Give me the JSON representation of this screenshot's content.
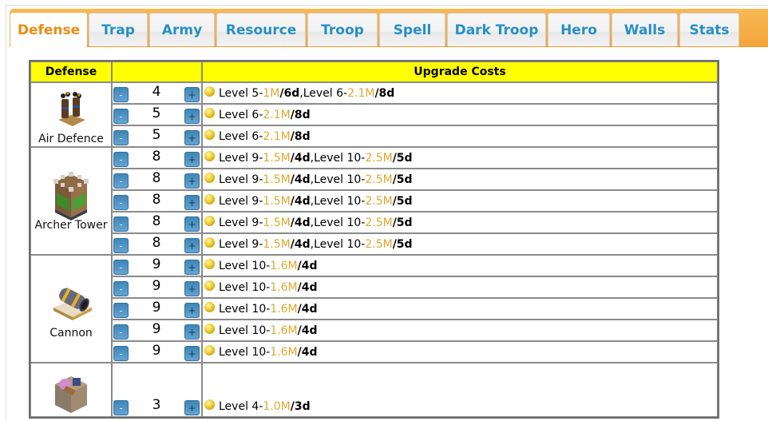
{
  "tabs": [
    {
      "label": "Defense",
      "active": true
    },
    {
      "label": "Trap",
      "active": false
    },
    {
      "label": "Army",
      "active": false
    },
    {
      "label": "Resource",
      "active": false
    },
    {
      "label": "Troop",
      "active": false
    },
    {
      "label": "Spell",
      "active": false
    },
    {
      "label": "Dark Troop",
      "active": false
    },
    {
      "label": "Hero",
      "active": false
    },
    {
      "label": "Walls",
      "active": false
    },
    {
      "label": "Stats",
      "active": false
    }
  ],
  "colors": {
    "tab_bar": "#f4a63a",
    "tab_text": "#2590c4",
    "tab_active_text": "#ef8a12",
    "header_bg": "#ffff00",
    "cost_gold": "#e0a82e",
    "button_blue": "#4f95c5"
  },
  "table": {
    "headers": {
      "defense": "Defense",
      "controls": "",
      "costs": "Upgrade Costs"
    },
    "minus_label": "-",
    "plus_label": "+",
    "buildings": [
      {
        "name": "Air Defence",
        "icon": "air-defence-icon",
        "rows": [
          {
            "level": "4",
            "costs": [
              {
                "level": "Level 5-",
                "amount": "1M",
                "time": "/6d"
              },
              {
                "level": "Level 6-",
                "amount": "2.1M",
                "time": "/8d"
              }
            ]
          },
          {
            "level": "5",
            "costs": [
              {
                "level": "Level 6-",
                "amount": "2.1M",
                "time": "/8d"
              }
            ]
          },
          {
            "level": "5",
            "costs": [
              {
                "level": "Level 6-",
                "amount": "2.1M",
                "time": "/8d"
              }
            ]
          }
        ]
      },
      {
        "name": "Archer Tower",
        "icon": "archer-tower-icon",
        "rows": [
          {
            "level": "8",
            "costs": [
              {
                "level": "Level 9-",
                "amount": "1.5M",
                "time": "/4d"
              },
              {
                "level": "Level 10-",
                "amount": "2.5M",
                "time": "/5d"
              }
            ]
          },
          {
            "level": "8",
            "costs": [
              {
                "level": "Level 9-",
                "amount": "1.5M",
                "time": "/4d"
              },
              {
                "level": "Level 10-",
                "amount": "2.5M",
                "time": "/5d"
              }
            ]
          },
          {
            "level": "8",
            "costs": [
              {
                "level": "Level 9-",
                "amount": "1.5M",
                "time": "/4d"
              },
              {
                "level": "Level 10-",
                "amount": "2.5M",
                "time": "/5d"
              }
            ]
          },
          {
            "level": "8",
            "costs": [
              {
                "level": "Level 9-",
                "amount": "1.5M",
                "time": "/4d"
              },
              {
                "level": "Level 10-",
                "amount": "2.5M",
                "time": "/5d"
              }
            ]
          },
          {
            "level": "8",
            "costs": [
              {
                "level": "Level 9-",
                "amount": "1.5M",
                "time": "/4d"
              },
              {
                "level": "Level 10-",
                "amount": "2.5M",
                "time": "/5d"
              }
            ]
          }
        ]
      },
      {
        "name": "Cannon",
        "icon": "cannon-icon",
        "rows": [
          {
            "level": "9",
            "costs": [
              {
                "level": "Level 10-",
                "amount": "1.6M",
                "time": "/4d"
              }
            ]
          },
          {
            "level": "9",
            "costs": [
              {
                "level": "Level 10-",
                "amount": "1.6M",
                "time": "/4d"
              }
            ]
          },
          {
            "level": "9",
            "costs": [
              {
                "level": "Level 10-",
                "amount": "1.6M",
                "time": "/4d"
              }
            ]
          },
          {
            "level": "9",
            "costs": [
              {
                "level": "Level 10-",
                "amount": "1.6M",
                "time": "/4d"
              }
            ]
          },
          {
            "level": "9",
            "costs": [
              {
                "level": "Level 10-",
                "amount": "1.6M",
                "time": "/4d"
              }
            ]
          }
        ]
      },
      {
        "name": "",
        "icon": "wizard-tower-icon",
        "partial": true,
        "rows": [
          {
            "level": "3",
            "costs": [
              {
                "level": "Level 4-",
                "amount": "1.0M",
                "time": "/3d"
              }
            ]
          }
        ]
      }
    ]
  }
}
